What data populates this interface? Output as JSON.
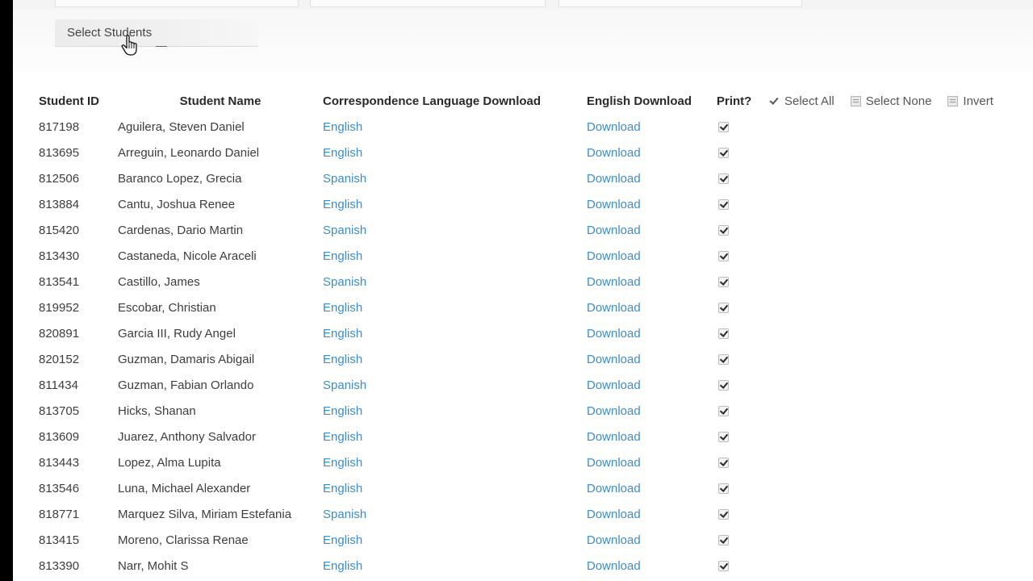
{
  "toolbar": {
    "select_students_label": "Select Students"
  },
  "table": {
    "headers": {
      "student_id": "Student ID",
      "student_name": "Student Name",
      "correspondence_language": "Correspondence Language Download",
      "english_download": "English Download",
      "print": "Print?"
    },
    "selection_tools": {
      "select_all": "Select All",
      "select_none": "Select None",
      "invert": "Invert"
    },
    "rows": [
      {
        "id": "817198",
        "name": "Aguilera, Steven Daniel",
        "language": "English",
        "download": "Download",
        "print": true
      },
      {
        "id": "813695",
        "name": "Arreguin, Leonardo Daniel",
        "language": "English",
        "download": "Download",
        "print": true
      },
      {
        "id": "812506",
        "name": "Baranco Lopez, Grecia",
        "language": "Spanish",
        "download": "Download",
        "print": true
      },
      {
        "id": "813884",
        "name": "Cantu, Joshua Renee",
        "language": "English",
        "download": "Download",
        "print": true
      },
      {
        "id": "815420",
        "name": "Cardenas, Dario Martin",
        "language": "Spanish",
        "download": "Download",
        "print": true
      },
      {
        "id": "813430",
        "name": "Castaneda, Nicole Araceli",
        "language": "English",
        "download": "Download",
        "print": true
      },
      {
        "id": "813541",
        "name": "Castillo, James",
        "language": "Spanish",
        "download": "Download",
        "print": true
      },
      {
        "id": "819952",
        "name": "Escobar, Christian",
        "language": "English",
        "download": "Download",
        "print": true
      },
      {
        "id": "820891",
        "name": "Garcia III, Rudy Angel",
        "language": "English",
        "download": "Download",
        "print": true
      },
      {
        "id": "820152",
        "name": "Guzman, Damaris Abigail",
        "language": "English",
        "download": "Download",
        "print": true
      },
      {
        "id": "811434",
        "name": "Guzman, Fabian Orlando",
        "language": "Spanish",
        "download": "Download",
        "print": true
      },
      {
        "id": "813705",
        "name": "Hicks, Shanan",
        "language": "English",
        "download": "Download",
        "print": true
      },
      {
        "id": "813609",
        "name": "Juarez, Anthony Salvador",
        "language": "English",
        "download": "Download",
        "print": true
      },
      {
        "id": "813443",
        "name": "Lopez, Alma Lupita",
        "language": "English",
        "download": "Download",
        "print": true
      },
      {
        "id": "813546",
        "name": "Luna, Michael Alexander",
        "language": "English",
        "download": "Download",
        "print": true
      },
      {
        "id": "818771",
        "name": "Marquez Silva, Miriam Estefania",
        "language": "Spanish",
        "download": "Download",
        "print": true
      },
      {
        "id": "813415",
        "name": "Moreno, Clarissa Renae",
        "language": "English",
        "download": "Download",
        "print": true
      },
      {
        "id": "813390",
        "name": "Narr, Mohit S",
        "language": "English",
        "download": "Download",
        "print": true
      }
    ]
  },
  "colors": {
    "link": "#3a8dcc",
    "header_text": "#2a2a2a",
    "body_text": "#3d3d3d"
  }
}
